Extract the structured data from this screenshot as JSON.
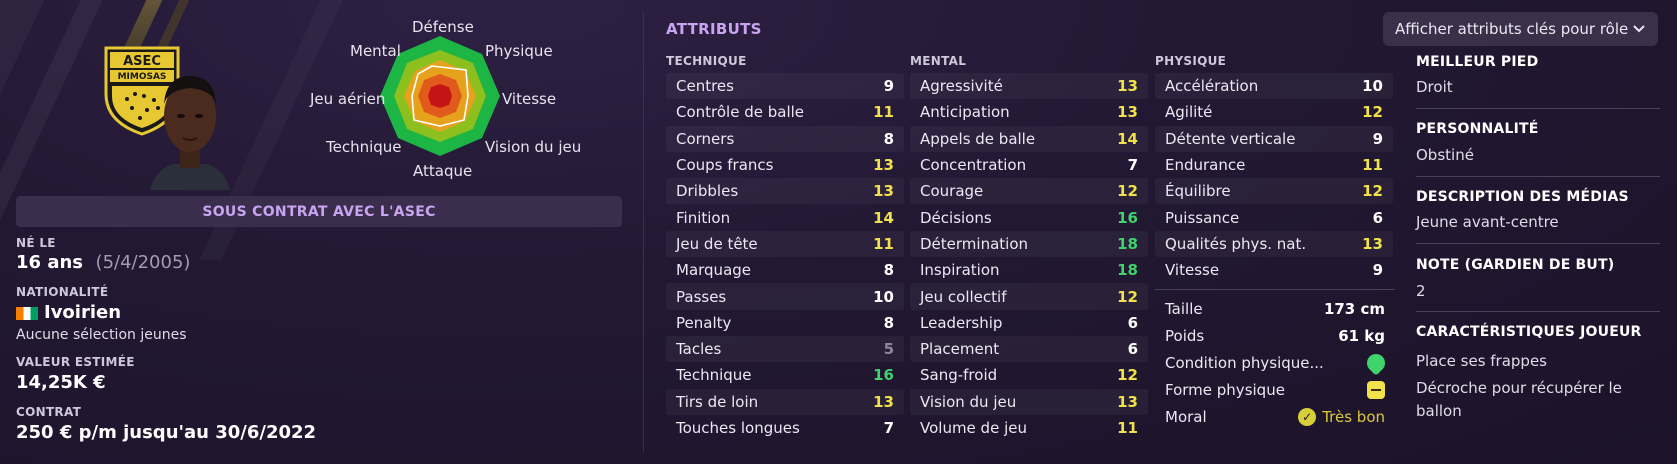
{
  "radar": {
    "labels": {
      "defense": "Défense",
      "physique": "Physique",
      "vitesse": "Vitesse",
      "vision": "Vision du jeu",
      "attaque": "Attaque",
      "technique": "Technique",
      "jeu_aerien": "Jeu aérien",
      "mental": "Mental"
    }
  },
  "crest": {
    "line1": "ASEC",
    "line2": "MIMOSAS"
  },
  "contract_banner": "SOUS CONTRAT AVEC L'ASEC",
  "info": {
    "born_label": "NÉ LE",
    "age": "16 ans",
    "birth_date": "(5/4/2005)",
    "nationality_label": "NATIONALITÉ",
    "nationality": "Ivoirien",
    "selections": "Aucune sélection jeunes",
    "value_label": "VALEUR ESTIMÉE",
    "value": "14,25K €",
    "contract_label": "CONTRAT",
    "contract": "250 € p/m jusqu'au 30/6/2022"
  },
  "attributes": {
    "title": "ATTRIBUTS",
    "technique_header": "TECHNIQUE",
    "mental_header": "MENTAL",
    "physique_header": "PHYSIQUE",
    "technique": [
      {
        "name": "Centres",
        "value": "9",
        "tone": "white"
      },
      {
        "name": "Contrôle de balle",
        "value": "11",
        "tone": "yellow"
      },
      {
        "name": "Corners",
        "value": "8",
        "tone": "white"
      },
      {
        "name": "Coups francs",
        "value": "13",
        "tone": "yellow"
      },
      {
        "name": "Dribbles",
        "value": "13",
        "tone": "yellow"
      },
      {
        "name": "Finition",
        "value": "14",
        "tone": "yellow"
      },
      {
        "name": "Jeu de tête",
        "value": "11",
        "tone": "yellow"
      },
      {
        "name": "Marquage",
        "value": "8",
        "tone": "white"
      },
      {
        "name": "Passes",
        "value": "10",
        "tone": "white"
      },
      {
        "name": "Penalty",
        "value": "8",
        "tone": "white"
      },
      {
        "name": "Tacles",
        "value": "5",
        "tone": "grey"
      },
      {
        "name": "Technique",
        "value": "16",
        "tone": "green"
      },
      {
        "name": "Tirs de loin",
        "value": "13",
        "tone": "yellow"
      },
      {
        "name": "Touches longues",
        "value": "7",
        "tone": "white"
      }
    ],
    "mental": [
      {
        "name": "Agressivité",
        "value": "13",
        "tone": "yellow"
      },
      {
        "name": "Anticipation",
        "value": "13",
        "tone": "yellow"
      },
      {
        "name": "Appels de balle",
        "value": "14",
        "tone": "yellow"
      },
      {
        "name": "Concentration",
        "value": "7",
        "tone": "white"
      },
      {
        "name": "Courage",
        "value": "12",
        "tone": "yellow"
      },
      {
        "name": "Décisions",
        "value": "16",
        "tone": "green"
      },
      {
        "name": "Détermination",
        "value": "18",
        "tone": "green"
      },
      {
        "name": "Inspiration",
        "value": "18",
        "tone": "green"
      },
      {
        "name": "Jeu collectif",
        "value": "12",
        "tone": "yellow"
      },
      {
        "name": "Leadership",
        "value": "6",
        "tone": "white"
      },
      {
        "name": "Placement",
        "value": "6",
        "tone": "white"
      },
      {
        "name": "Sang-froid",
        "value": "12",
        "tone": "yellow"
      },
      {
        "name": "Vision du jeu",
        "value": "13",
        "tone": "yellow"
      },
      {
        "name": "Volume de jeu",
        "value": "11",
        "tone": "yellow"
      }
    ],
    "physique": [
      {
        "name": "Accélération",
        "value": "10",
        "tone": "white"
      },
      {
        "name": "Agilité",
        "value": "12",
        "tone": "yellow"
      },
      {
        "name": "Détente verticale",
        "value": "9",
        "tone": "white"
      },
      {
        "name": "Endurance",
        "value": "11",
        "tone": "yellow"
      },
      {
        "name": "Équilibre",
        "value": "12",
        "tone": "yellow"
      },
      {
        "name": "Puissance",
        "value": "6",
        "tone": "white"
      },
      {
        "name": "Qualités phys. nat.",
        "value": "13",
        "tone": "yellow"
      },
      {
        "name": "Vitesse",
        "value": "9",
        "tone": "white"
      }
    ],
    "extra": {
      "height_label": "Taille",
      "height": "173 cm",
      "weight_label": "Poids",
      "weight": "61 kg",
      "condition_label": "Condition physique...",
      "form_label": "Forme physique",
      "morale_label": "Moral",
      "morale": "Très bon"
    }
  },
  "dropdown": {
    "label": "Afficher attributs clés pour rôle"
  },
  "right": {
    "foot_label": "MEILLEUR PIED",
    "foot": "Droit",
    "personality_label": "PERSONNALITÉ",
    "personality": "Obstiné",
    "media_label": "DESCRIPTION DES MÉDIAS",
    "media": "Jeune avant-centre",
    "gk_label": "NOTE (GARDIEN DE BUT)",
    "gk": "2",
    "traits_label": "CARACTÉRISTIQUES JOUEUR",
    "trait1": "Place ses frappes",
    "trait2_line1": "Décroche pour récupérer le",
    "trait2_line2": "ballon"
  },
  "colors": {
    "accent": "#c9a4f0",
    "yellow": "#f1e14a",
    "green": "#3fd36b",
    "background": "#1f1530"
  }
}
